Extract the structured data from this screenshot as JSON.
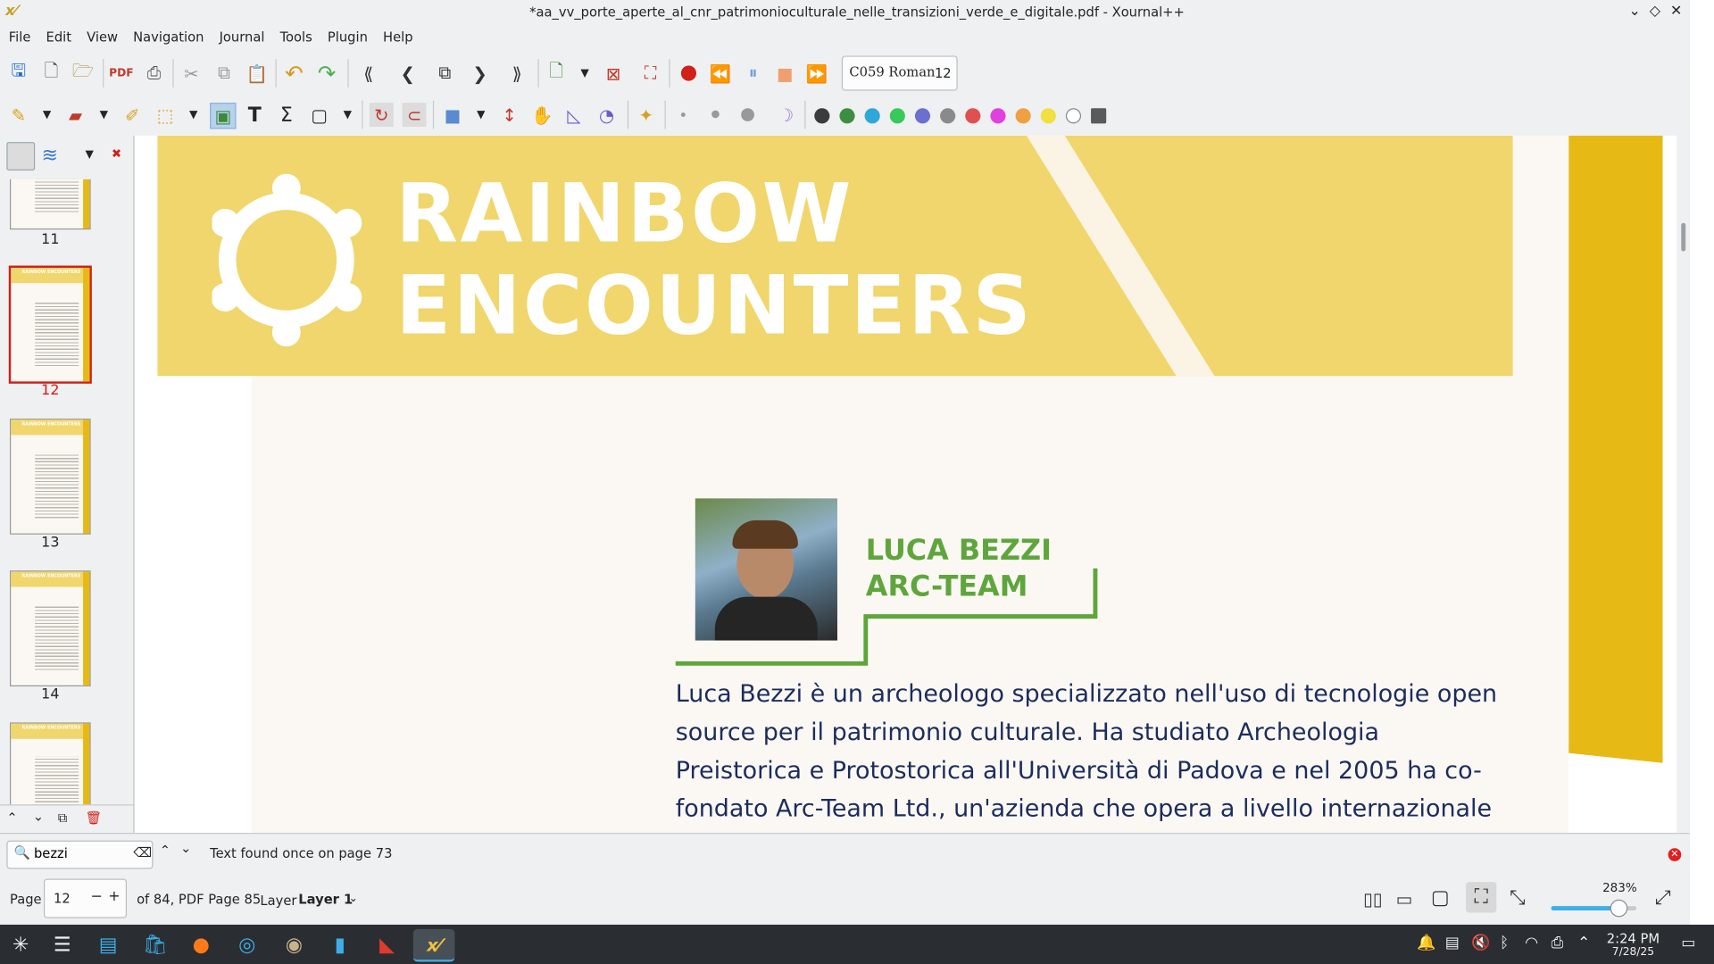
{
  "window": {
    "title": "*aa_vv_porte_aperte_al_cnr_patrimonioculturale_nelle_transizioni_verde_e_digitale.pdf - Xournal++",
    "app_icon": "x-icon",
    "controls": [
      "chevron-down-icon",
      "diamond-icon",
      "close-icon"
    ]
  },
  "menu": [
    "File",
    "Edit",
    "View",
    "Navigation",
    "Journal",
    "Tools",
    "Plugin",
    "Help"
  ],
  "toolbar": {
    "font_name": "C059 Roman",
    "font_size": "12",
    "colors": [
      "#3c3c3c",
      "#3e8e41",
      "#2ea8d8",
      "#39c95a",
      "#6b6fd0",
      "#8a8a8a",
      "#e05050",
      "#e040e0",
      "#f0a040",
      "#f0e040",
      "#ffffff",
      "#5a5a5a"
    ]
  },
  "sidebar": {
    "thumbnails": [
      {
        "label": "11",
        "selected": false
      },
      {
        "label": "12",
        "selected": true
      },
      {
        "label": "13",
        "selected": false
      },
      {
        "label": "14",
        "selected": false
      },
      {
        "label": "",
        "selected": false
      }
    ],
    "thumb_title": "RAINBOW ENCOUNTERS"
  },
  "document": {
    "banner_line1": "RAINBOW",
    "banner_line2": "ENCOUNTERS",
    "name_line1": "LUCA BEZZI",
    "name_line2": "ARC-TEAM",
    "body_lines": [
      "Luca Bezzi è un archeologo specializzato nell'uso di tecnologie open",
      "source per il patrimonio culturale. Ha studiato Archeologia",
      "Preistorica e Protostorica all'Università di Padova e nel 2005 ha co-",
      "fondato Arc-Team Ltd., un'azienda che opera a livello internazionale"
    ],
    "accent_color": "#e6b915",
    "banner_color": "#f0d66c",
    "green_color": "#5ea63c",
    "text_color": "#1c2d5c"
  },
  "search": {
    "value": "bezzi",
    "result": "Text found once on page 73"
  },
  "status": {
    "page_label": "Page",
    "page_value": "12",
    "of_text": "of 84, PDF Page 85",
    "layer_label": "Layer",
    "layer_value": "Layer 1",
    "zoom": "283%"
  },
  "taskbar": {
    "time": "2:24 PM",
    "date": "7/28/25"
  }
}
